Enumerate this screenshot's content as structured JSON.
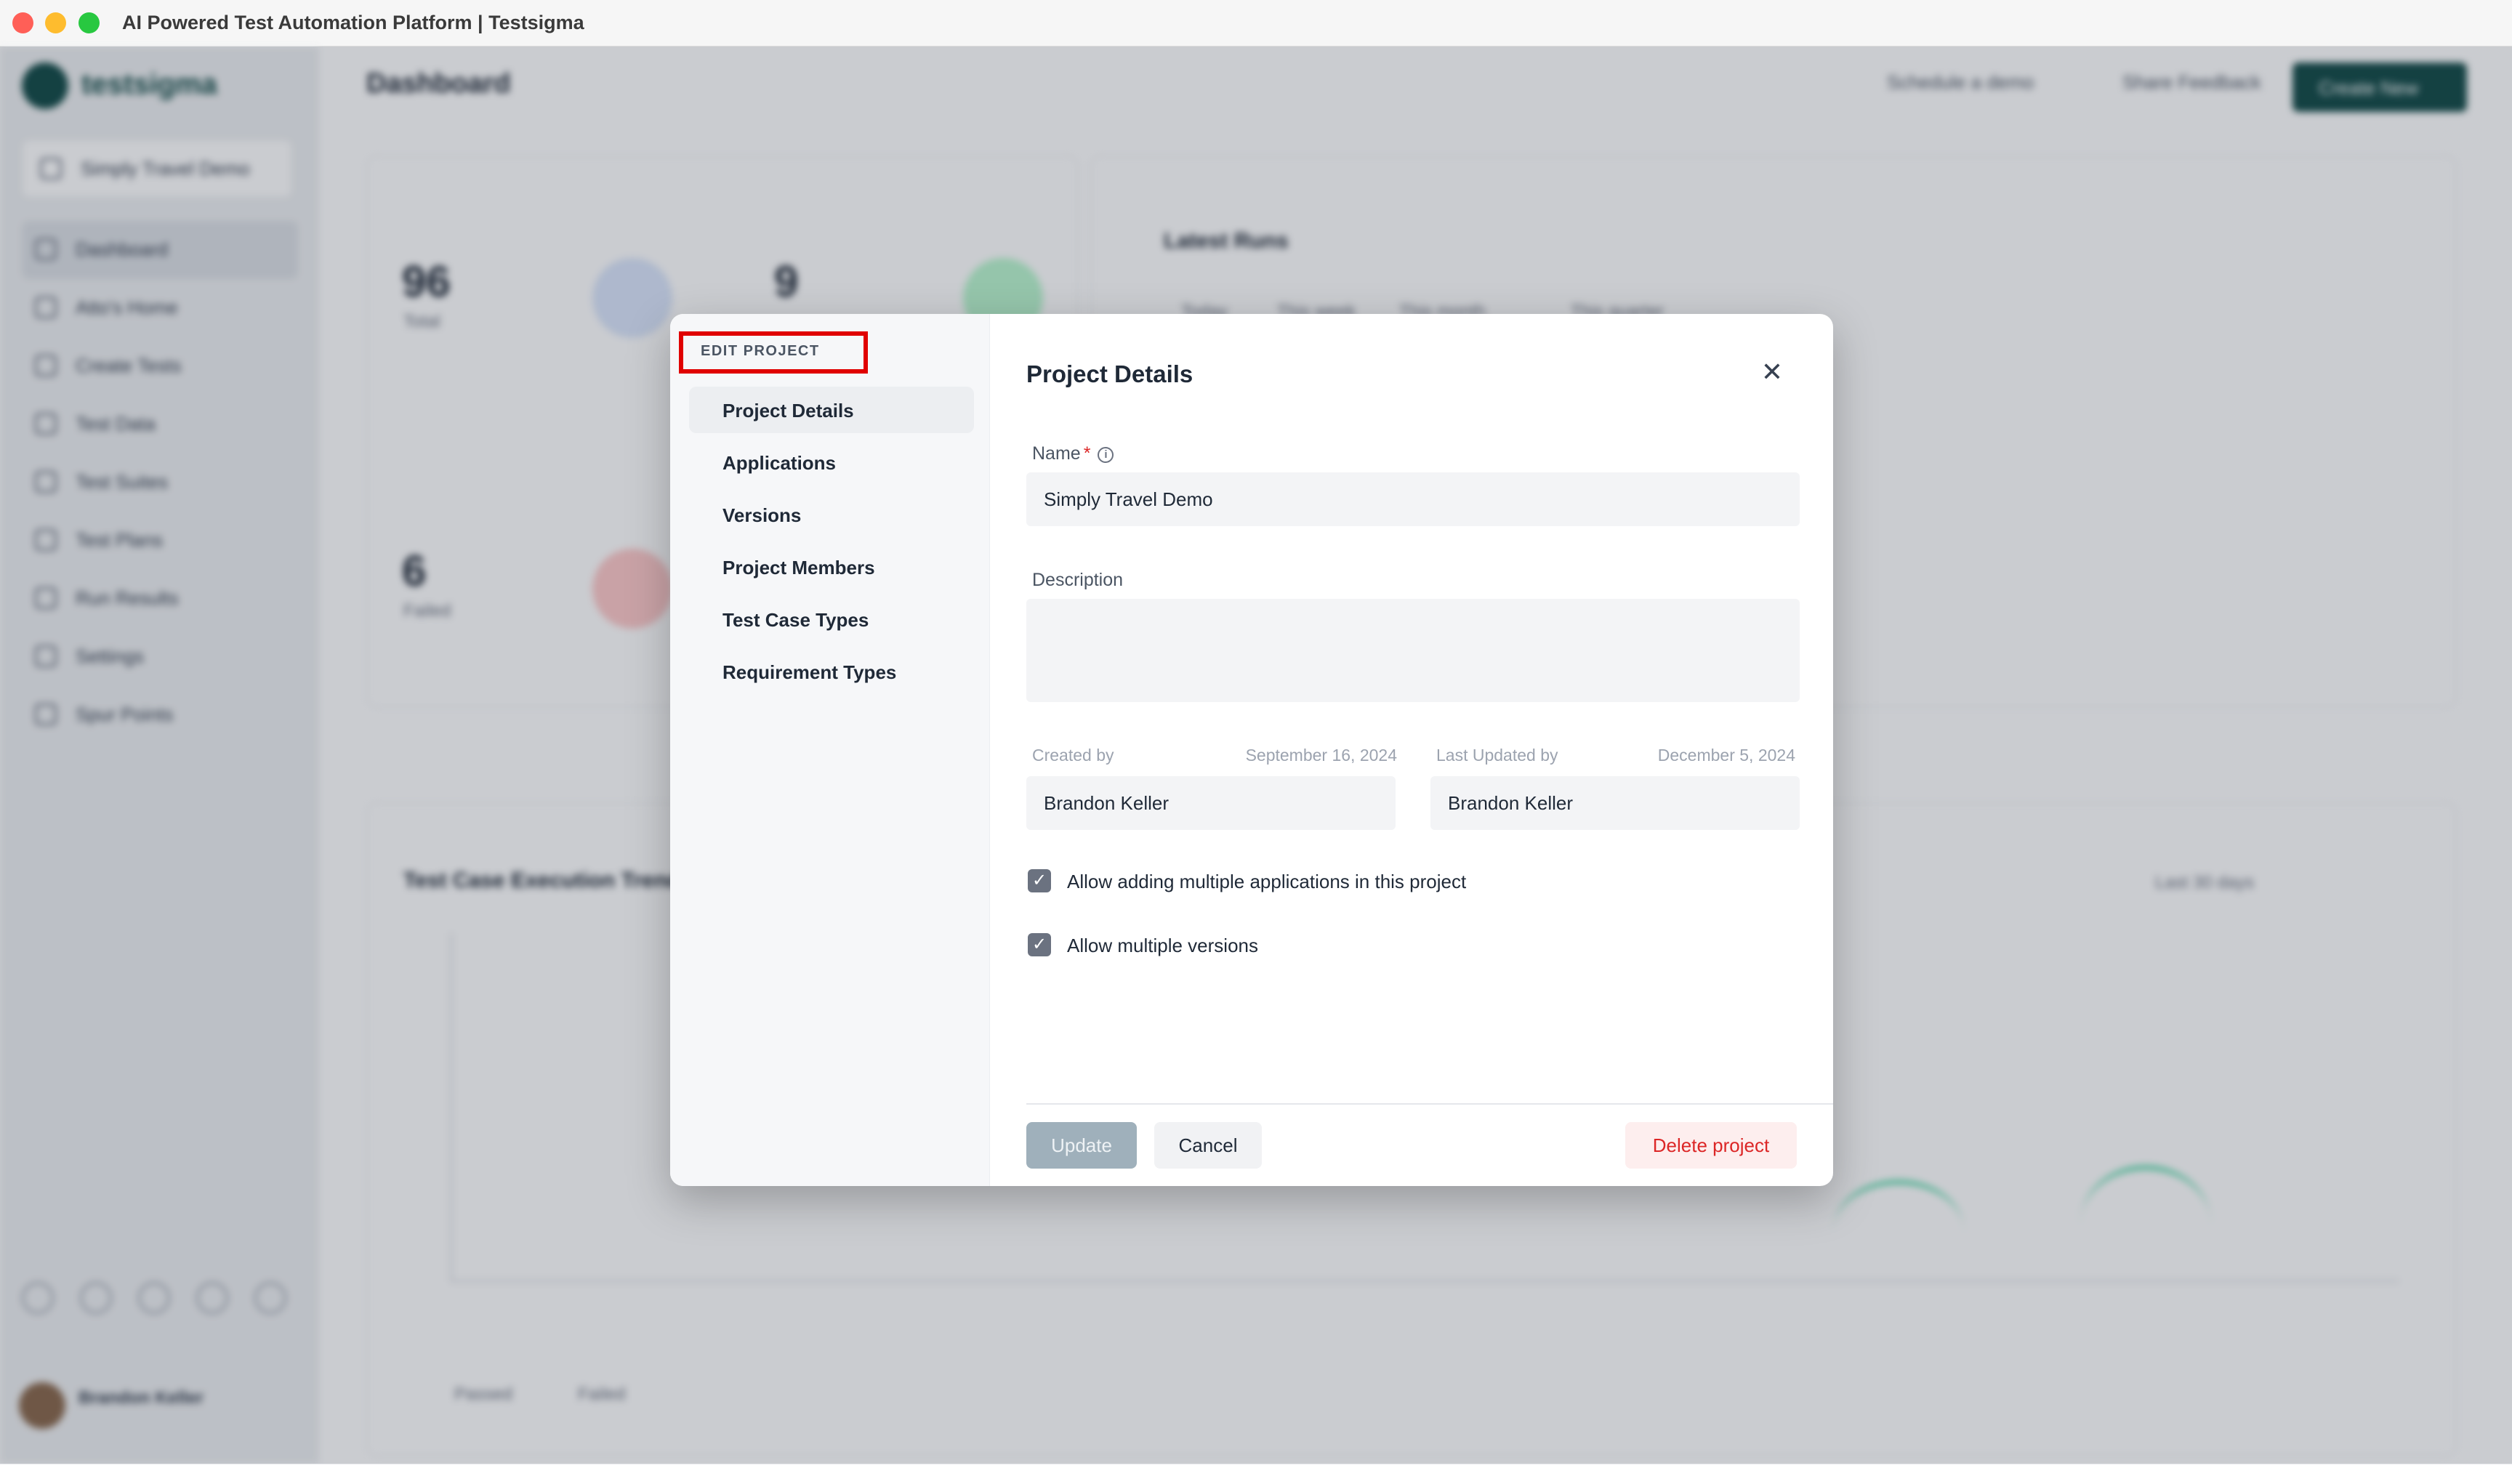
{
  "window": {
    "title": "AI Powered Test Automation Platform | Testsigma"
  },
  "background": {
    "logo_text": "testsigma",
    "project_switcher": "Simply Travel Demo",
    "page_title": "Dashboard",
    "topbar_links": [
      "Schedule a demo",
      "Share Feedback"
    ],
    "create_button": "Create New",
    "nav_items": [
      "Dashboard",
      "Atto's Home",
      "Create Tests",
      "Test Data",
      "Test Suites",
      "Test Plans",
      "Run Results",
      "Settings",
      "Spur Points"
    ],
    "stats": [
      {
        "value": "96",
        "label": "Total"
      },
      {
        "value": "9",
        "label": ""
      },
      {
        "value": "6",
        "label": "Failed"
      }
    ],
    "latest_runs_title": "Latest Runs",
    "run_tabs": [
      "Today",
      "This week",
      "This month",
      "This quarter"
    ],
    "chart_title": "Test Case Execution Trend",
    "range_select": "Last 30 days",
    "legend": [
      "Passed",
      "Failed"
    ],
    "user_name": "Brandon Keller",
    "colors": {
      "accent": "#164d4a",
      "passed": "#34d399",
      "failed": "#ef4444"
    }
  },
  "modal": {
    "nav_heading": "EDIT PROJECT",
    "nav_items": [
      "Project Details",
      "Applications",
      "Versions",
      "Project Members",
      "Test Case Types",
      "Requirement Types"
    ],
    "active_nav": "Project Details",
    "title": "Project Details",
    "close_icon": "close-icon",
    "name_label": "Name",
    "name_required": "*",
    "name_value": "Simply Travel Demo",
    "description_label": "Description",
    "description_value": "",
    "created_by_label": "Created by",
    "created_date": "September 16, 2024",
    "created_by_value": "Brandon Keller",
    "updated_by_label": "Last Updated by",
    "updated_date": "December 5, 2024",
    "updated_by_value": "Brandon Keller",
    "checkbox_multi_apps": {
      "label": "Allow adding multiple applications in this project",
      "checked": true
    },
    "checkbox_multi_versions": {
      "label": "Allow multiple versions",
      "checked": true
    },
    "update_button": "Update",
    "cancel_button": "Cancel",
    "delete_button": "Delete project"
  }
}
